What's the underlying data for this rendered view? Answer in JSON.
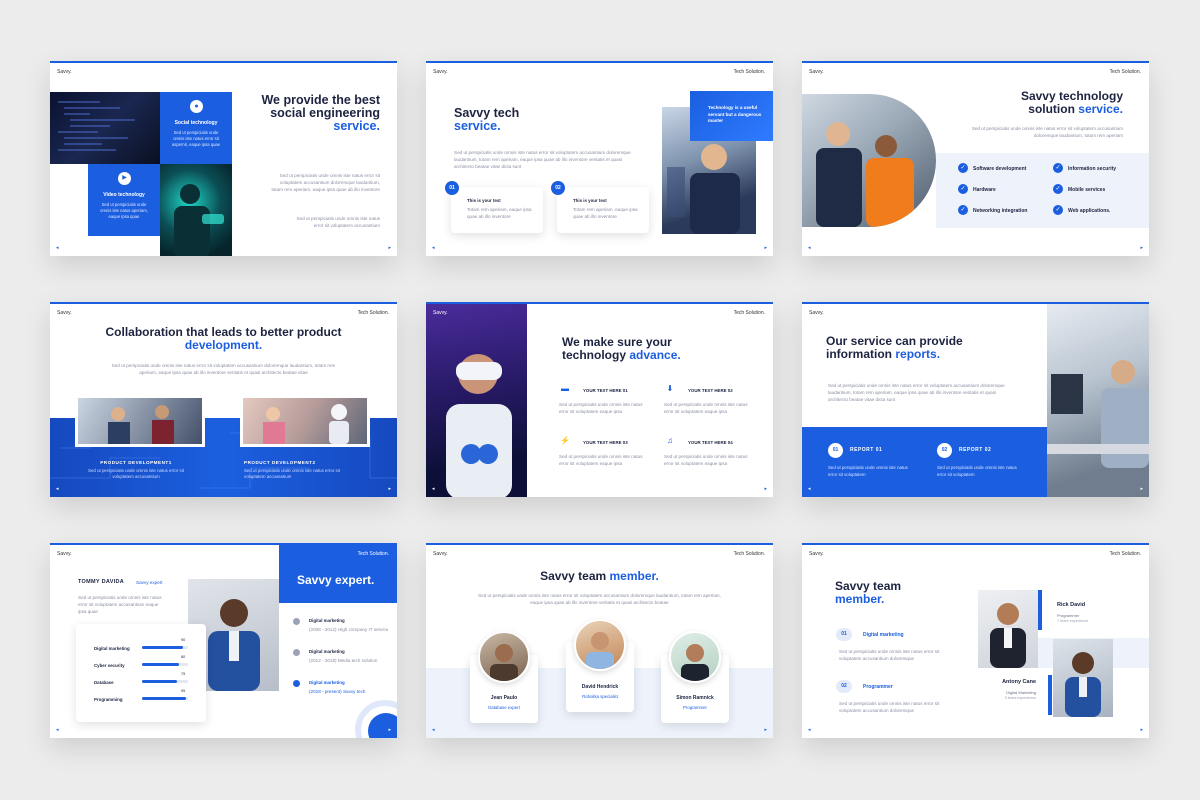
{
  "common": {
    "brand": "Savvy.",
    "tag": "Tech Solution.",
    "prev": "◂",
    "next": "▸"
  },
  "s1": {
    "title": "We provide the best social engineering",
    "title_accent": "service",
    "dot": ".",
    "box1_title": "Social technology",
    "box1_text": "Sed ut perspiciatis unde omnis iste natus error sit aspernit, eaque ipsa quae",
    "box2_title": "Video technology",
    "box2_text": "Sed ut perspiciatis unde omnis iste natus aperiam, eaque ipsa quae",
    "para1": "Sed ut perspiciatis unde omnis iste natus error sit voluptatem accusantium doloremque laudantium, totam rem aperiam, eaque ipsa quae ab illo inventore",
    "para2": "Sed ut perspiciatis unde omnis iste natus error sit voluptatem accusantium"
  },
  "s2": {
    "title": "Savvy tech",
    "title_accent": "service",
    "dot": ".",
    "para": "Sed ut perspiciatis unde omnis iste natus error sit voluptatem accusantium doloremque laudantium, totam rem aperiam, eaque ipsa quae ab illo inventore veritatis et quasi architecto beatae vitae dicta sunt",
    "callout": "Technology is a useful servant but a dangerous master",
    "card1_num": "01",
    "card1_title": "This is your text",
    "card1_text": "Totam rem aperiam, eaque ipsa quae ab illo inventore",
    "card2_num": "02",
    "card2_title": "This is your text",
    "card2_text": "Totam rem aperiam, eaque ipsa quae ab illo inventore"
  },
  "s3": {
    "title": "Savvy technology solution",
    "title_accent": "service",
    "dot": ".",
    "para": "Sed ut perspiciatis unde omnis iste natus error sit voluptatem accusantium doloremque laudantium, totam rem aperiam",
    "items": [
      "Software development",
      "Information security",
      "Hardware",
      "Mobile services",
      "Networking integration",
      "Web applications."
    ]
  },
  "s4": {
    "title": "Collaboration that leads to better product",
    "title_accent": "development",
    "dot": ".",
    "para": "Sed ut perspiciatis unde omnis iste natus error sit voluptatem accusantium doloremque laudantium, totam rem aperiam, eaque ipsa quae ab illo inventore veritatis et quasi architecto beatae vitae",
    "col1_title": "PRODUCT DEVELOPMENT1",
    "col1_text": "Sed ut perspiciatis unde omnis iste natus error sit voluptatem accusantium",
    "col2_title": "PRODUCT DEVELOPMENT2",
    "col2_text": "Sed ut perspiciatis unde omnis iste natus error sit voluptatem accusantium"
  },
  "s5": {
    "title": "We make sure your technology",
    "title_accent": "advance",
    "dot": ".",
    "items": [
      {
        "title": "YOUR TEXT HERE 01",
        "text": "Sed ut perspiciatis unde omnis iste natus error sit voluptatem eaque ipsa"
      },
      {
        "title": "YOUR TEXT HERE 02",
        "text": "Sed ut perspiciatis unde omnis iste natus error sit voluptatem eaque ipsa"
      },
      {
        "title": "YOUR TEXT HERE 03",
        "text": "Sed ut perspiciatis unde omnis iste natus error sit voluptatem eaque ipsa"
      },
      {
        "title": "YOUR TEXT HERE 04",
        "text": "Sed ut perspiciatis unde omnis iste natus error sit voluptatem eaque ipsa"
      }
    ]
  },
  "s6": {
    "title": "Our service can provide information",
    "title_accent": "reports",
    "dot": ".",
    "para": "Sed ut perspiciatis unde omnis iste natus error sit voluptatem accusantium doloremque laudantium, totam rem aperiam, eaque ipsa quae ab illo inventore veritatis et quasi architecto beatae vitae dicta sunt",
    "r1_num": "01",
    "r1_title": "REPORT 01",
    "r1_text": "Sed ut perspiciatis unde omnis iste natus error sit voluptatem",
    "r2_num": "02",
    "r2_title": "REPORT 02",
    "r2_text": "Sed ut perspiciatis unde omnis iste natus error sit voluptatem"
  },
  "s7": {
    "name": "TOMMY DAVIDA",
    "role": "Savvy expert",
    "para": "Sed ut perspiciatis unde omnis iste natus error sit voluptatem accusantium eaque ipsa quae",
    "title": "Savvy expert.",
    "skills": [
      {
        "label": "Digital marketing",
        "value": 90
      },
      {
        "label": "Cyber security",
        "value": 80
      },
      {
        "label": "Database",
        "value": 75
      },
      {
        "label": "Programming",
        "value": 95
      }
    ],
    "timeline": [
      {
        "title": "Digital marketing",
        "text": "(2008 - 2012) High company IT service"
      },
      {
        "title": "Digital marketing",
        "text": "(2012 - 2018) Media tech solution"
      },
      {
        "title": "Digital marketing",
        "text": "(2018 - present) Savvy tech"
      }
    ]
  },
  "s8": {
    "title": "Savvy team",
    "title_accent": "member",
    "dot": ".",
    "para": "Sed ut perspiciatis unde omnis iste natus error sit voluptatem accusantium doloremque laudantium, totam rem aperiam, eaque ipsa quae ab illo inventore veritatis et quasi architecto beatae",
    "members": [
      {
        "name": "Jean Paulo",
        "role": "Database expert"
      },
      {
        "name": "David Hendrick",
        "role": "Roboitka specialist"
      },
      {
        "name": "Simon Ramnick",
        "role": "Programmer"
      }
    ]
  },
  "s9": {
    "title": "Savvy team",
    "title_accent": "member",
    "dot": ".",
    "i1_num": "01",
    "i1_title": "Digital marketing",
    "i1_text": "Sed ut perspiciatis unde omnis iste natus error sit voluptatem accusantium doloremque",
    "i2_num": "02",
    "i2_title": "Programmer",
    "i2_text": "Sed ut perspiciatis unde omnis iste natus error sit voluptatem accusantium doloremque",
    "m1_name": "Rick David",
    "m1_role": "Programmer",
    "m1_exp": "7 tears experience",
    "m2_name": "Antony Cane",
    "m2_role": "Digital Marketing",
    "m2_exp": "5 tears experience"
  }
}
